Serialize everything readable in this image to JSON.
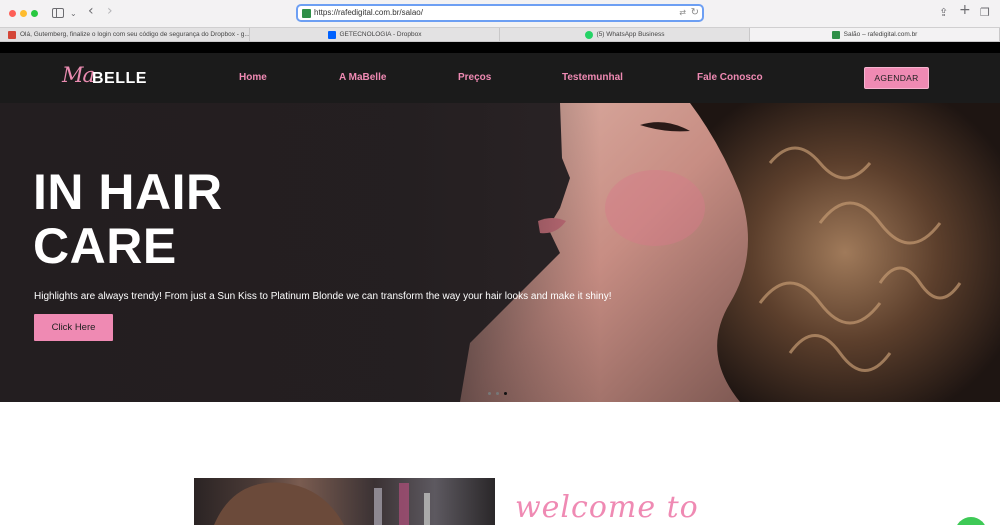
{
  "browser": {
    "url": "https://rafedigital.com.br/salao/",
    "tabs": [
      {
        "label": "Olá, Gutemberg, finalize o login com seu código de segurança do Dropbox - g...",
        "favicon": "gmail-icon",
        "color": "#d44638"
      },
      {
        "label": "GETECNOLOGIA - Dropbox",
        "favicon": "dropbox-icon",
        "color": "#0061fe"
      },
      {
        "label": "(5) WhatsApp Business",
        "favicon": "whatsapp-icon",
        "color": "#25d366"
      },
      {
        "label": "Salão – rafedigital.com.br",
        "favicon": "site-icon",
        "color": "#2f8f48"
      }
    ]
  },
  "site": {
    "logo": {
      "script": "Ma",
      "word": "BELLE"
    },
    "nav": [
      {
        "label": "Home"
      },
      {
        "label": "A MaBelle"
      },
      {
        "label": "Preços"
      },
      {
        "label": "Testemunhal"
      },
      {
        "label": "Fale Conosco"
      }
    ],
    "cta_label": "AGENDAR",
    "hero": {
      "title": "IN HAIR CARE",
      "text": "Highlights are always trendy! From just a Sun Kiss to Platinum Blonde we can transform the way your hair looks and make it shiny!",
      "button": "Click Here",
      "slides": 3,
      "active_slide": 3
    },
    "welcome": "welcome to",
    "colors": {
      "accent": "#ef8ab3",
      "nav_bg": "#1b1b1b",
      "top_strip": "#000000"
    }
  }
}
